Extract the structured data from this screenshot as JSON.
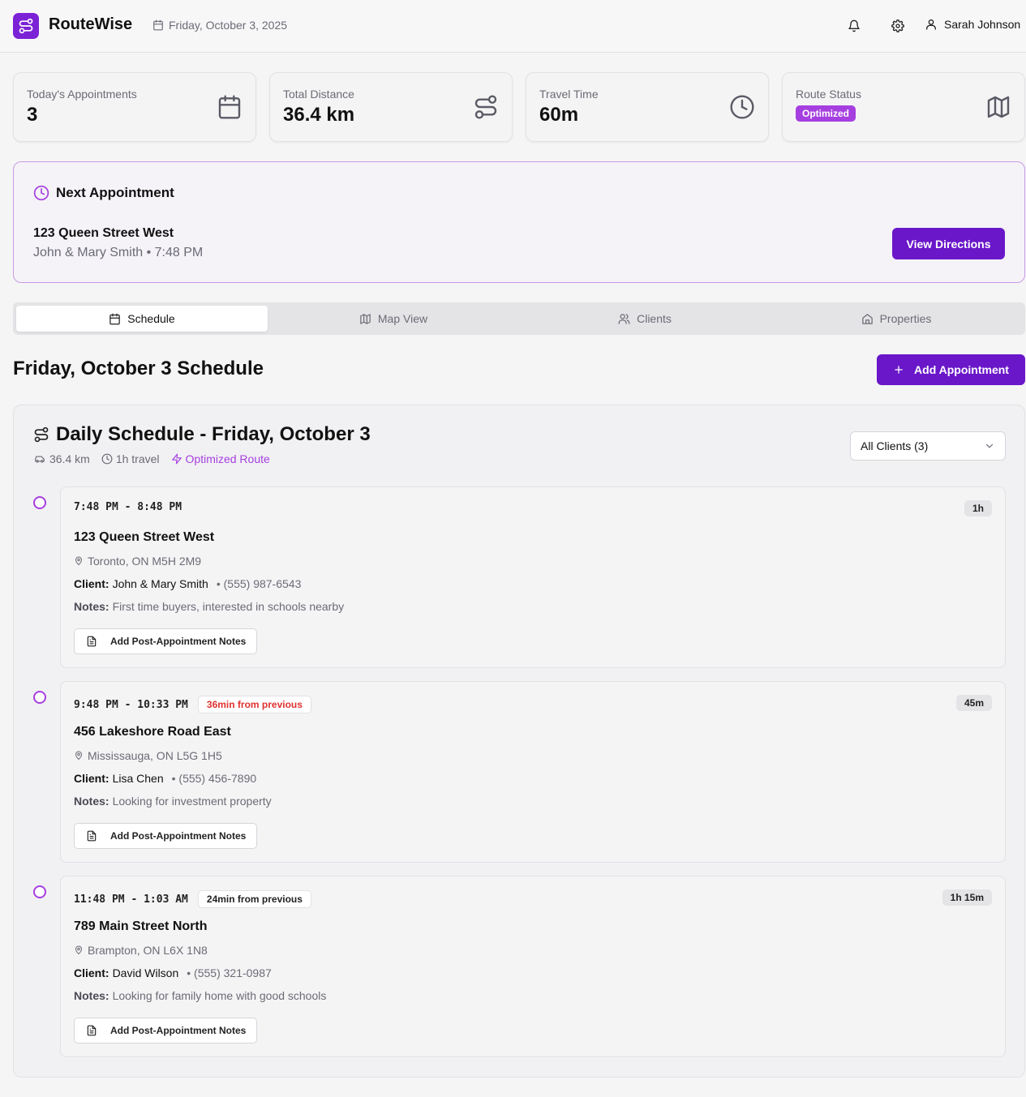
{
  "header": {
    "app_name": "RouteWise",
    "date": "Friday, October 3, 2025",
    "user_name": "Sarah Johnson"
  },
  "stats": [
    {
      "label": "Today's Appointments",
      "value": "3",
      "icon": "calendar-icon"
    },
    {
      "label": "Total Distance",
      "value": "36.4 km",
      "icon": "route-icon"
    },
    {
      "label": "Travel Time",
      "value": "60m",
      "icon": "clock-icon"
    },
    {
      "label": "Route Status",
      "badge": "Optimized",
      "icon": "map-icon"
    }
  ],
  "next_appointment": {
    "title": "Next Appointment",
    "address": "123 Queen Street West",
    "subtitle": "John & Mary Smith • 7:48 PM",
    "button": "View Directions"
  },
  "tabs": [
    {
      "label": "Schedule",
      "icon": "calendar-icon",
      "active": true
    },
    {
      "label": "Map View",
      "icon": "map-icon",
      "active": false
    },
    {
      "label": "Clients",
      "icon": "users-icon",
      "active": false
    },
    {
      "label": "Properties",
      "icon": "home-icon",
      "active": false
    }
  ],
  "schedule": {
    "heading": "Friday, October 3 Schedule",
    "add_button": "Add Appointment",
    "card_title": "Daily Schedule - Friday, October 3",
    "distance": "36.4 km",
    "travel": "1h travel",
    "optimized": "Optimized Route",
    "filter": "All Clients (3)",
    "client_label": "Client:",
    "notes_label": "Notes:",
    "notes_button": "Add Post-Appointment Notes"
  },
  "appointments": [
    {
      "time": "7:48 PM - 8:48 PM",
      "travel": "",
      "duration": "1h",
      "address": "123 Queen Street West",
      "city": "Toronto, ON M5H 2M9",
      "client": "John & Mary Smith",
      "phone": "• (555) 987-6543",
      "notes": "First time buyers, interested in schools nearby"
    },
    {
      "time": "9:48 PM - 10:33 PM",
      "travel": "36min from previous",
      "duration": "45m",
      "address": "456 Lakeshore Road East",
      "city": "Mississauga, ON L5G 1H5",
      "client": "Lisa Chen",
      "phone": "• (555) 456-7890",
      "notes": "Looking for investment property"
    },
    {
      "time": "11:48 PM - 1:03 AM",
      "travel": "24min from previous",
      "duration": "1h 15m",
      "address": "789 Main Street North",
      "city": "Brampton, ON L6X 1N8",
      "client": "David Wilson",
      "phone": "• (555) 321-0987",
      "notes": "Looking for family home with good schools"
    }
  ],
  "colors": {
    "brand": "#7b22d6",
    "accent": "#a63fe0",
    "warning": "#e03131"
  }
}
